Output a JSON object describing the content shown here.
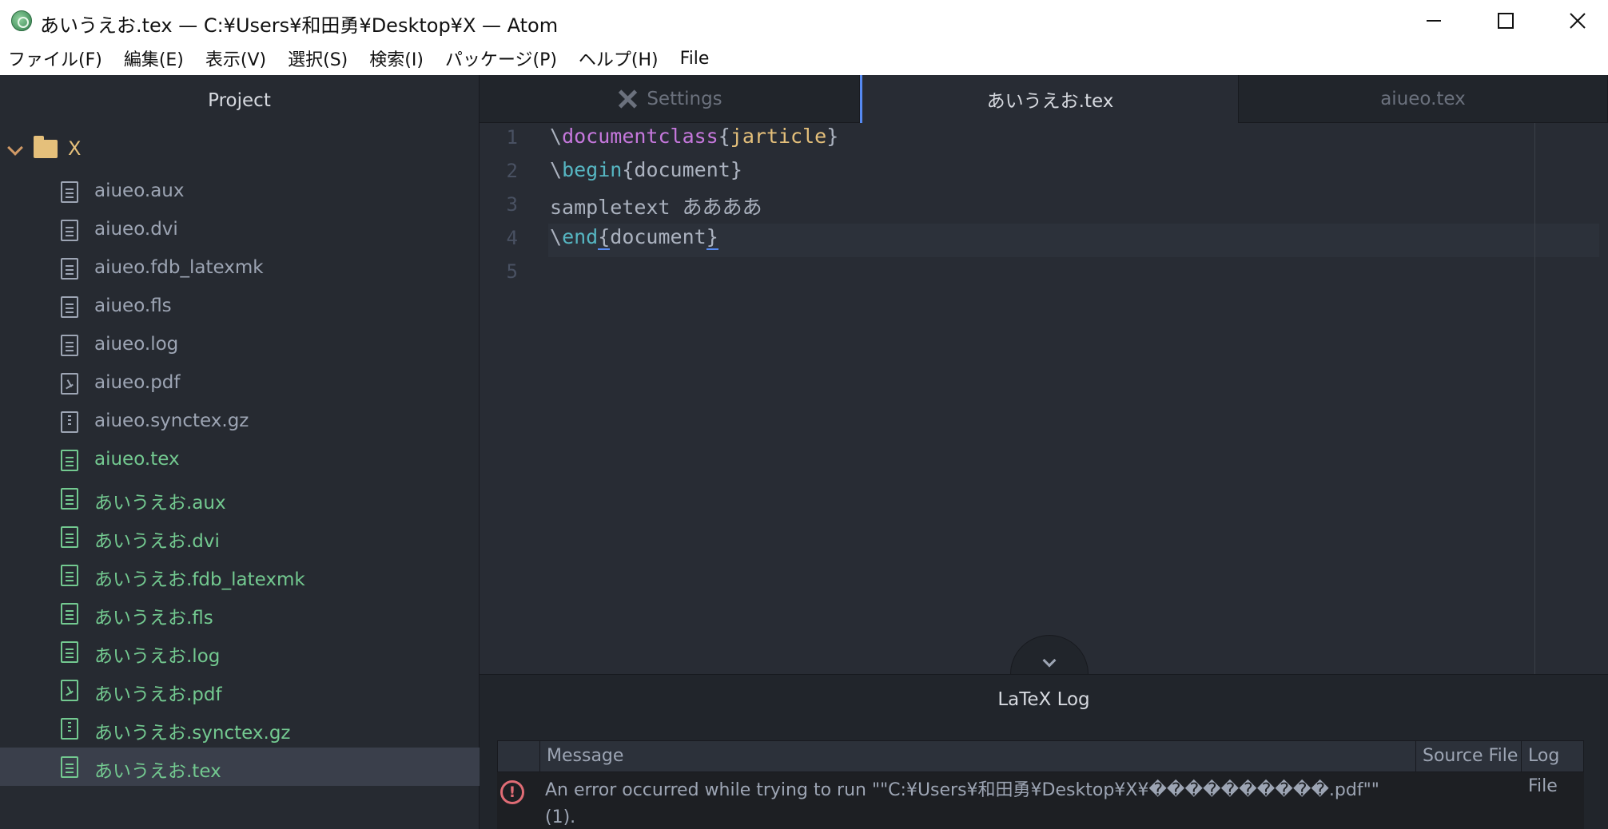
{
  "window": {
    "title": "あいうえお.tex — C:¥Users¥和田勇¥Desktop¥X — Atom"
  },
  "menu": [
    "ファイル(F)",
    "編集(E)",
    "表示(V)",
    "選択(S)",
    "検索(I)",
    "パッケージ(P)",
    "ヘルプ(H)",
    "File"
  ],
  "sidebar": {
    "title": "Project",
    "root": "X",
    "files": [
      {
        "name": "aiueo.aux",
        "status": "normal",
        "icon": "file-text-icon"
      },
      {
        "name": "aiueo.dvi",
        "status": "normal",
        "icon": "file-text-icon"
      },
      {
        "name": "aiueo.fdb_latexmk",
        "status": "normal",
        "icon": "file-text-icon"
      },
      {
        "name": "aiueo.fls",
        "status": "normal",
        "icon": "file-text-icon"
      },
      {
        "name": "aiueo.log",
        "status": "normal",
        "icon": "file-text-icon"
      },
      {
        "name": "aiueo.pdf",
        "status": "normal",
        "icon": "file-pdf-icon"
      },
      {
        "name": "aiueo.synctex.gz",
        "status": "normal",
        "icon": "file-zip-icon"
      },
      {
        "name": "aiueo.tex",
        "status": "added",
        "icon": "file-text-icon"
      },
      {
        "name": "あいうえお.aux",
        "status": "added",
        "icon": "file-text-icon"
      },
      {
        "name": "あいうえお.dvi",
        "status": "added",
        "icon": "file-text-icon"
      },
      {
        "name": "あいうえお.fdb_latexmk",
        "status": "added",
        "icon": "file-text-icon"
      },
      {
        "name": "あいうえお.fls",
        "status": "added",
        "icon": "file-text-icon"
      },
      {
        "name": "あいうえお.log",
        "status": "added",
        "icon": "file-text-icon"
      },
      {
        "name": "あいうえお.pdf",
        "status": "added",
        "icon": "file-pdf-icon"
      },
      {
        "name": "あいうえお.synctex.gz",
        "status": "added",
        "icon": "file-zip-icon"
      },
      {
        "name": "あいうえお.tex",
        "status": "added",
        "icon": "file-text-icon",
        "selected": true
      }
    ]
  },
  "tabs": [
    {
      "label": "Settings",
      "icon": "tools-icon",
      "active": false
    },
    {
      "label": "あいうえお.tex",
      "active": true
    },
    {
      "label": "aiueo.tex",
      "active": false
    }
  ],
  "editor": {
    "line_numbers": [
      "1",
      "2",
      "3",
      "4",
      "5"
    ],
    "lines": [
      {
        "p1": "\\",
        "cmd": "documentclass",
        "p2": "{",
        "arg": "jarticle",
        "p3": "}"
      },
      {
        "p1": "\\",
        "cmd": "begin",
        "p2": "{",
        "arg": "document",
        "p3": "}"
      },
      {
        "text": "sampletext ああああ"
      },
      {
        "p1": "\\",
        "cmd": "end",
        "p2": "{",
        "arg": "document",
        "p3": "}"
      },
      {
        "text": ""
      }
    ]
  },
  "log_panel": {
    "title": "LaTeX Log",
    "columns": {
      "message": "Message",
      "source": "Source File",
      "log": "Log File"
    },
    "entries": [
      {
        "type": "error",
        "icon_glyph": "!",
        "message": "An error occurred while trying to run \"\"C:¥Users¥和田勇¥Desktop¥X¥����������.pdf\"\" (1)."
      }
    ]
  },
  "colors": {
    "accent": "#568af2",
    "git_added": "#73c990",
    "error": "#e06c75"
  }
}
